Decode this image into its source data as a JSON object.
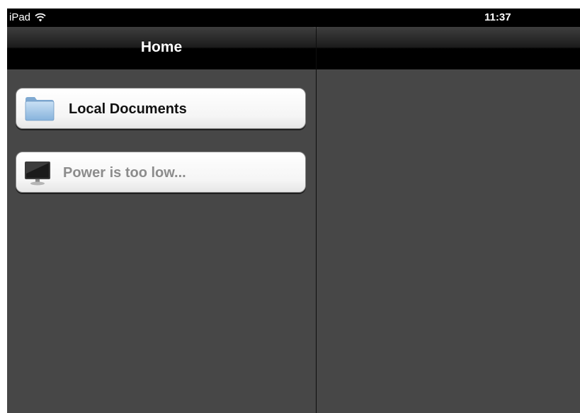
{
  "status_bar": {
    "carrier": "iPad",
    "time": "11:37"
  },
  "master": {
    "nav_title": "Home",
    "items": [
      {
        "label": "Local Documents",
        "icon": "folder-icon",
        "enabled": true
      },
      {
        "label": "Power is too low...",
        "icon": "computer-icon",
        "enabled": false
      }
    ]
  },
  "detail": {
    "nav_title": ""
  },
  "colors": {
    "background": "#444444",
    "status_bar": "#000000",
    "cell_text": "#111111",
    "disabled_text": "#8c8c8c",
    "folder_blue": "#9cc3e6"
  }
}
